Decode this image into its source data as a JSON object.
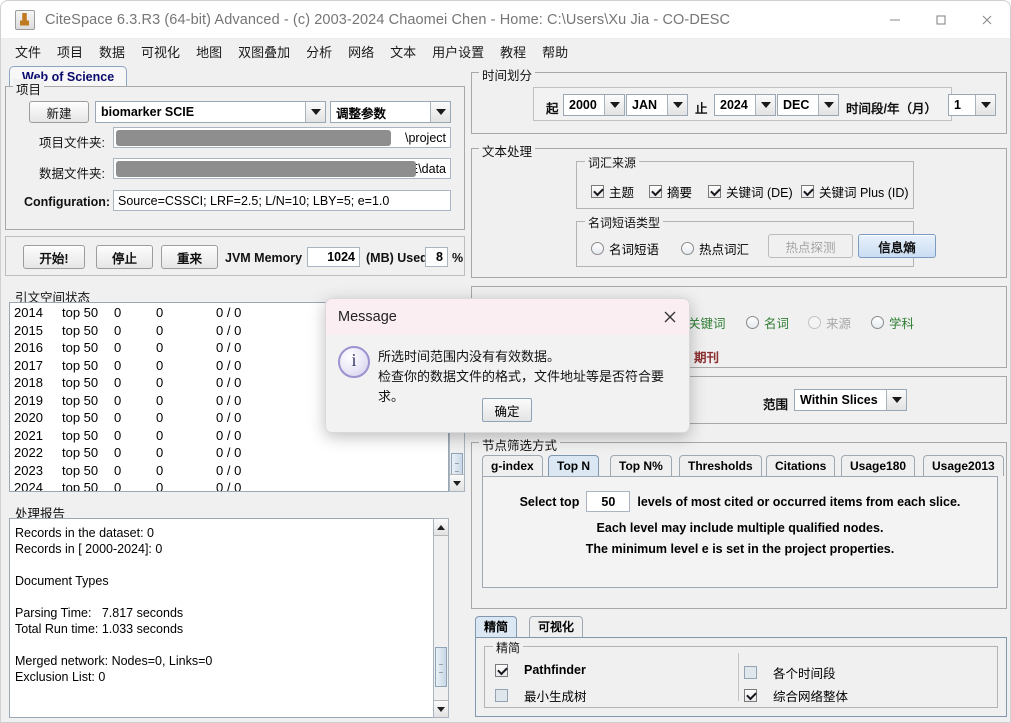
{
  "window": {
    "title": "CiteSpace 6.3.R3 (64-bit) Advanced - (c) 2003-2024 Chaomei Chen - Home: C:\\Users\\Xu Jia - CO-DESC",
    "app_icon": "java-coffee-cup-icon",
    "minimize": "minimize-icon",
    "maximize": "maximize-icon",
    "close": "close-icon"
  },
  "menubar": {
    "items": [
      {
        "label": "文件"
      },
      {
        "label": "项目"
      },
      {
        "label": "数据"
      },
      {
        "label": "可视化"
      },
      {
        "label": "地图"
      },
      {
        "label": "双图叠加"
      },
      {
        "label": "分析"
      },
      {
        "label": "网络"
      },
      {
        "label": "文本"
      },
      {
        "label": "用户设置"
      },
      {
        "label": "教程"
      },
      {
        "label": "帮助"
      }
    ]
  },
  "source_tab": {
    "label": "Web of Science"
  },
  "project": {
    "group_label": "项目",
    "new_button": "新建",
    "project_combo_value": "biomarker SCIE",
    "params_combo_value": "调整参数",
    "project_folder_label": "项目文件夹:",
    "project_folder_value": "\\project",
    "data_folder_label": "数据文件夹:",
    "data_folder_value": "E\\data",
    "configuration_label": "Configuration:",
    "configuration_value": "Source=CSSCI; LRF=2.5; L/N=10; LBY=5; e=1.0"
  },
  "run_bar": {
    "start_button": "开始!",
    "stop_button": "停止",
    "reset_button": "重来",
    "jvm_label": "JVM Memory",
    "jvm_value": "1024",
    "mb_used_label": "(MB) Used",
    "used_percent": "8",
    "percent_sign": "%"
  },
  "citation_space": {
    "group_label": "引文空间状态",
    "rows": [
      {
        "year": "2014",
        "top": "top 50",
        "a": "0",
        "b": "0",
        "c": "0 / 0"
      },
      {
        "year": "2015",
        "top": "top 50",
        "a": "0",
        "b": "0",
        "c": "0 / 0"
      },
      {
        "year": "2016",
        "top": "top 50",
        "a": "0",
        "b": "0",
        "c": "0 / 0"
      },
      {
        "year": "2017",
        "top": "top 50",
        "a": "0",
        "b": "0",
        "c": "0 / 0"
      },
      {
        "year": "2018",
        "top": "top 50",
        "a": "0",
        "b": "0",
        "c": "0 / 0"
      },
      {
        "year": "2019",
        "top": "top 50",
        "a": "0",
        "b": "0",
        "c": "0 / 0"
      },
      {
        "year": "2020",
        "top": "top 50",
        "a": "0",
        "b": "0",
        "c": "0 / 0"
      },
      {
        "year": "2021",
        "top": "top 50",
        "a": "0",
        "b": "0",
        "c": "0 / 0"
      },
      {
        "year": "2022",
        "top": "top 50",
        "a": "0",
        "b": "0",
        "c": "0 / 0"
      },
      {
        "year": "2023",
        "top": "top 50",
        "a": "0",
        "b": "0",
        "c": "0 / 0"
      },
      {
        "year": "2024",
        "top": "top 50",
        "a": "0",
        "b": "0",
        "c": "0 / 0"
      }
    ]
  },
  "report": {
    "group_label": "处理报告",
    "text": "Records in the dataset: 0\nRecords in [ 2000-2024]: 0\n\nDocument Types\n\nParsing Time:   7.817 seconds\nTotal Run time: 1.033 seconds\n\nMerged network: Nodes=0, Links=0\nExclusion List: 0"
  },
  "time_slicing": {
    "group_label": "时间划分",
    "from_label": "起",
    "from_year": "2000",
    "from_month": "JAN",
    "to_label": "止",
    "to_year": "2024",
    "to_month": "DEC",
    "slice_label": "时间段/年（月）",
    "slice_value": "1"
  },
  "text_processing": {
    "group_label": "文本处理",
    "term_source": {
      "group_label": "词汇来源",
      "items": [
        {
          "label": "主题",
          "checked": true
        },
        {
          "label": "摘要",
          "checked": true
        },
        {
          "label": "关键词 (DE)",
          "checked": true
        },
        {
          "label": "关键词 Plus (ID)",
          "checked": true
        }
      ]
    },
    "term_type": {
      "group_label": "名词短语类型",
      "radios": [
        {
          "label": "名词短语",
          "selected": false
        },
        {
          "label": "热点词汇",
          "selected": false
        }
      ],
      "burst_button": "热点探测",
      "entropy_button": "信息熵"
    }
  },
  "node_types": {
    "items": [
      {
        "label": "关键词",
        "color": "#2e7d32",
        "selected": false
      },
      {
        "label": "名词",
        "color": "#2e7d32",
        "selected": false
      },
      {
        "label": "来源",
        "color": "#a8a8a8",
        "selected": false
      },
      {
        "label": "学科",
        "color": "#2e7d32",
        "selected": false
      }
    ],
    "journal_label": "期刊",
    "journal_color": "#8b2f2f"
  },
  "links": {
    "scope_label": "范围",
    "scope_value": "Within Slices"
  },
  "node_selection": {
    "group_label": "节点筛选方式",
    "tabs": [
      {
        "label": "g-index",
        "selected": false
      },
      {
        "label": "Top N",
        "selected": true
      },
      {
        "label": "Top N%",
        "selected": false
      },
      {
        "label": "Thresholds",
        "selected": false
      },
      {
        "label": "Citations",
        "selected": false
      },
      {
        "label": "Usage180",
        "selected": false
      },
      {
        "label": "Usage2013",
        "selected": false
      }
    ],
    "select_top_prefix": "Select top",
    "top_value": "50",
    "select_top_suffix": "levels of most cited or occurred items from each slice.",
    "line2": "Each level may include multiple qualified nodes.",
    "line3": "The minimum level e is set in the project properties."
  },
  "pruning": {
    "tabs": [
      {
        "label": "精简",
        "selected": true
      },
      {
        "label": "可视化",
        "selected": false
      }
    ],
    "group_label": "精简",
    "options": [
      {
        "label": "Pathfinder",
        "checked": true
      },
      {
        "label": "最小生成树",
        "checked": false
      },
      {
        "label": "各个时间段",
        "checked": false
      },
      {
        "label": "综合网络整体",
        "checked": true
      }
    ]
  },
  "dialog": {
    "title": "Message",
    "close_icon": "close-icon",
    "info_icon": "info-icon",
    "line1": "所选时间范围内没有有效数据。",
    "line2": "检查你的数据文件的格式，文件地址等是否符合要求。",
    "ok_button": "确定"
  }
}
